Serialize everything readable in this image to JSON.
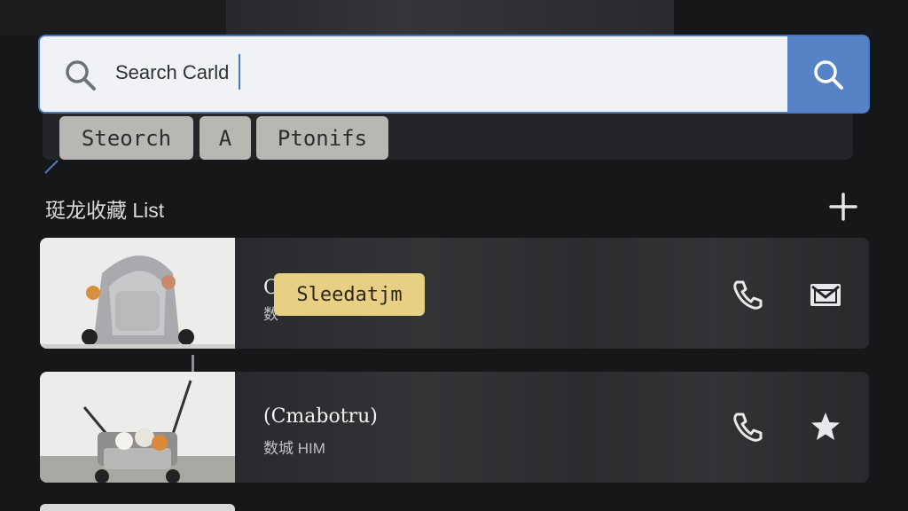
{
  "search": {
    "placeholder": "Search Carld"
  },
  "chips": [
    "Steorch",
    "A",
    "Ptonifs"
  ],
  "list": {
    "title": "珽龙收藏 List"
  },
  "cards": [
    {
      "title": "C",
      "subtitle": "数",
      "tooltip": "Sleedatjm",
      "actions": [
        "phone-icon",
        "mail-icon"
      ]
    },
    {
      "title": "(Cmabotru)",
      "subtitle": "数城 HIM",
      "actions": [
        "phone-icon",
        "star-icon"
      ]
    }
  ],
  "colors": {
    "accent": "#5583c6",
    "tooltip": "#e7cf84",
    "background": "#161719"
  }
}
